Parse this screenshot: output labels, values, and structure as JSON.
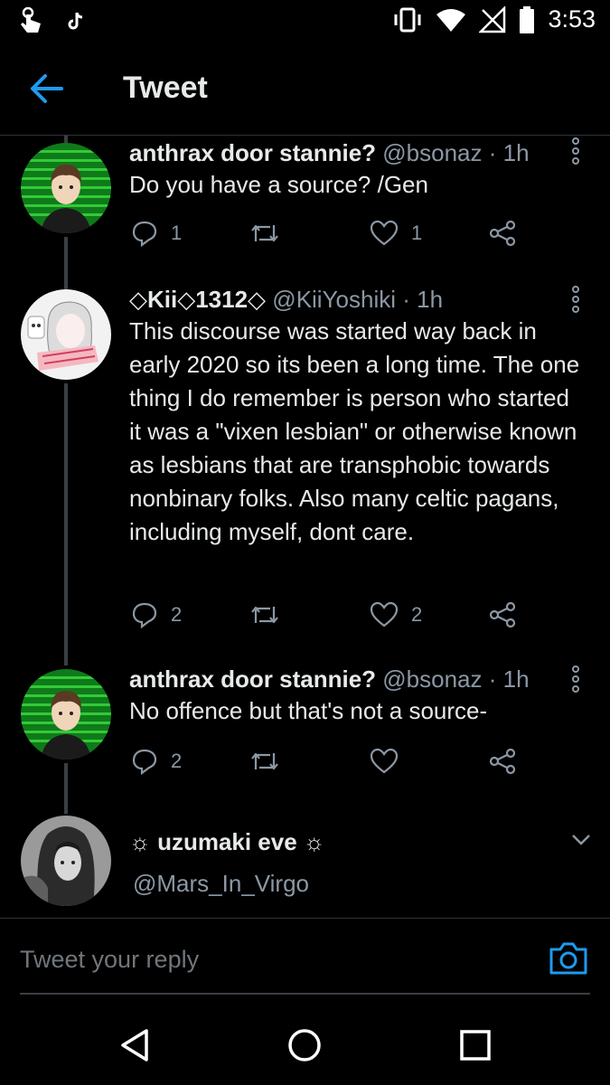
{
  "status_bar": {
    "time": "3:53"
  },
  "header": {
    "title": "Tweet"
  },
  "tweets": [
    {
      "name": "anthrax door stannie?",
      "handle": "@bsonaz",
      "time": "· 1h",
      "text": "Do you have a source? /Gen",
      "replies": "1",
      "retweets": "",
      "likes": "1"
    },
    {
      "name": "◇Kii◇1312◇",
      "handle": "@KiiYoshiki",
      "time": "· 1h",
      "text": "This discourse was started way back in early 2020 so its been a long time. The one thing I do remember is person who started it was a \"vixen lesbian\" or otherwise known as lesbians that are transphobic towards nonbinary folks. Also many celtic pagans, including myself, dont care.",
      "replies": "2",
      "retweets": "",
      "likes": "2"
    },
    {
      "name": "anthrax door stannie?",
      "handle": "@bsonaz",
      "time": "· 1h",
      "text": "No offence but that's not a source-",
      "replies": "2",
      "retweets": "",
      "likes": ""
    }
  ],
  "replying_account": {
    "name": "uzumaki eve",
    "handle": "@Mars_In_Virgo"
  },
  "reply_box": {
    "placeholder": "Tweet your reply"
  },
  "colors": {
    "accent": "#1d9bf0",
    "background": "#000000",
    "secondary_text": "#8b98a5"
  },
  "icons": [
    "back-arrow-icon",
    "reply-icon",
    "retweet-icon",
    "like-icon",
    "share-icon",
    "more-vertical-icon",
    "camera-icon",
    "chevron-down-icon"
  ]
}
